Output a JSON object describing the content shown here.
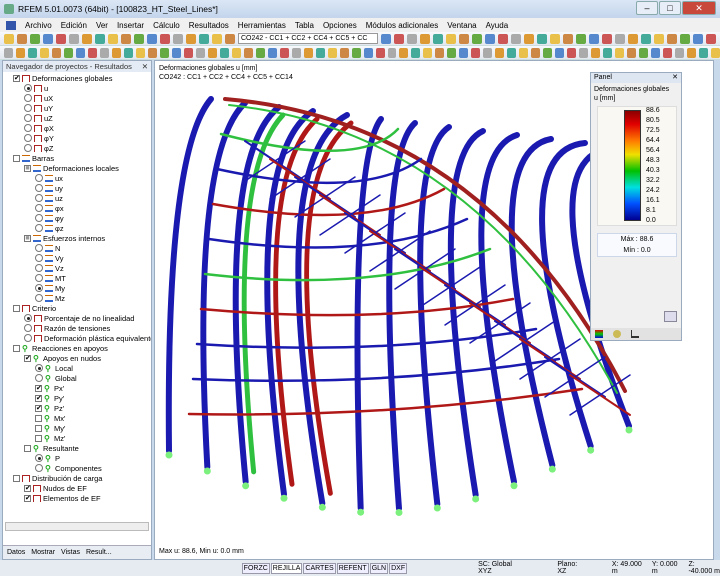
{
  "window": {
    "title": "RFEM 5.01.0073 (64bit) - [100823_HT_Steel_Lines*]",
    "min": "–",
    "max": "□",
    "close": "✕"
  },
  "menu": [
    "Archivo",
    "Edición",
    "Ver",
    "Insertar",
    "Cálculo",
    "Resultados",
    "Herramientas",
    "Tabla",
    "Opciones",
    "Módulos adicionales",
    "Ventana",
    "Ayuda"
  ],
  "toolbar": {
    "load_combo": "CO242 - CC1 + CC2 + CC4 + CC5 + CC"
  },
  "navigator": {
    "title": "Navegador de proyectos - Resultados",
    "close": "✕",
    "pin": "ᵖ",
    "nodes": [
      {
        "label": "Deformaciones globales",
        "lvl": 0,
        "ctl": "cb",
        "state": "on",
        "icon": "def"
      },
      {
        "label": "u",
        "lvl": 1,
        "ctl": "rb",
        "state": "on",
        "icon": "def"
      },
      {
        "label": "uX",
        "lvl": 1,
        "ctl": "rb",
        "state": "off",
        "icon": "def"
      },
      {
        "label": "uY",
        "lvl": 1,
        "ctl": "rb",
        "state": "off",
        "icon": "def"
      },
      {
        "label": "uZ",
        "lvl": 1,
        "ctl": "rb",
        "state": "off",
        "icon": "def"
      },
      {
        "label": "φX",
        "lvl": 1,
        "ctl": "rb",
        "state": "off",
        "icon": "def"
      },
      {
        "label": "φY",
        "lvl": 1,
        "ctl": "rb",
        "state": "off",
        "icon": "def"
      },
      {
        "label": "φZ",
        "lvl": 1,
        "ctl": "rb",
        "state": "off",
        "icon": "def"
      },
      {
        "label": "Barras",
        "lvl": 0,
        "ctl": "cb",
        "state": "off",
        "icon": "bar"
      },
      {
        "label": "Deformaciones locales",
        "lvl": 1,
        "ctl": "cb",
        "state": "part",
        "icon": "bar"
      },
      {
        "label": "ux",
        "lvl": 2,
        "ctl": "rb",
        "state": "off",
        "icon": "bar"
      },
      {
        "label": "uy",
        "lvl": 2,
        "ctl": "rb",
        "state": "off",
        "icon": "bar"
      },
      {
        "label": "uz",
        "lvl": 2,
        "ctl": "rb",
        "state": "off",
        "icon": "bar"
      },
      {
        "label": "φx",
        "lvl": 2,
        "ctl": "rb",
        "state": "off",
        "icon": "bar"
      },
      {
        "label": "φy",
        "lvl": 2,
        "ctl": "rb",
        "state": "off",
        "icon": "bar"
      },
      {
        "label": "φz",
        "lvl": 2,
        "ctl": "rb",
        "state": "off",
        "icon": "bar"
      },
      {
        "label": "Esfuerzos internos",
        "lvl": 1,
        "ctl": "cb",
        "state": "part",
        "icon": "bar"
      },
      {
        "label": "N",
        "lvl": 2,
        "ctl": "rb",
        "state": "off",
        "icon": "bar"
      },
      {
        "label": "Vy",
        "lvl": 2,
        "ctl": "rb",
        "state": "off",
        "icon": "bar"
      },
      {
        "label": "Vz",
        "lvl": 2,
        "ctl": "rb",
        "state": "off",
        "icon": "bar"
      },
      {
        "label": "MT",
        "lvl": 2,
        "ctl": "rb",
        "state": "off",
        "icon": "bar"
      },
      {
        "label": "My",
        "lvl": 2,
        "ctl": "rb",
        "state": "on",
        "icon": "bar"
      },
      {
        "label": "Mz",
        "lvl": 2,
        "ctl": "rb",
        "state": "off",
        "icon": "bar"
      },
      {
        "label": "Criterio",
        "lvl": 0,
        "ctl": "cb",
        "state": "off",
        "icon": "def"
      },
      {
        "label": "Porcentaje de no linealidad",
        "lvl": 1,
        "ctl": "rb",
        "state": "on",
        "icon": "def"
      },
      {
        "label": "Razón de tensiones",
        "lvl": 1,
        "ctl": "rb",
        "state": "off",
        "icon": "def"
      },
      {
        "label": "Deformación plástica equivalente",
        "lvl": 1,
        "ctl": "rb",
        "state": "off",
        "icon": "def"
      },
      {
        "label": "Reacciones en apoyos",
        "lvl": 0,
        "ctl": "cb",
        "state": "off",
        "icon": "sup"
      },
      {
        "label": "Apoyos en nudos",
        "lvl": 1,
        "ctl": "cb",
        "state": "on",
        "icon": "sup"
      },
      {
        "label": "Local",
        "lvl": 2,
        "ctl": "rb",
        "state": "on",
        "icon": "sup"
      },
      {
        "label": "Global",
        "lvl": 2,
        "ctl": "rb",
        "state": "off",
        "icon": "sup"
      },
      {
        "label": "Px'",
        "lvl": 2,
        "ctl": "cb",
        "state": "on",
        "icon": "sup"
      },
      {
        "label": "Py'",
        "lvl": 2,
        "ctl": "cb",
        "state": "on",
        "icon": "sup"
      },
      {
        "label": "Pz'",
        "lvl": 2,
        "ctl": "cb",
        "state": "on",
        "icon": "sup"
      },
      {
        "label": "Mx'",
        "lvl": 2,
        "ctl": "cb",
        "state": "off",
        "icon": "sup"
      },
      {
        "label": "My'",
        "lvl": 2,
        "ctl": "cb",
        "state": "off",
        "icon": "sup"
      },
      {
        "label": "Mz'",
        "lvl": 2,
        "ctl": "cb",
        "state": "off",
        "icon": "sup"
      },
      {
        "label": "Resultante",
        "lvl": 1,
        "ctl": "cb",
        "state": "off",
        "icon": "sup"
      },
      {
        "label": "P",
        "lvl": 2,
        "ctl": "rb",
        "state": "on",
        "icon": "sup"
      },
      {
        "label": "Componentes",
        "lvl": 2,
        "ctl": "rb",
        "state": "off",
        "icon": "sup"
      },
      {
        "label": "Distribución de carga",
        "lvl": 0,
        "ctl": "cb",
        "state": "off",
        "icon": "def"
      },
      {
        "label": "Nudos de EF",
        "lvl": 1,
        "ctl": "cb",
        "state": "on",
        "icon": "def"
      },
      {
        "label": "Elementos de EF",
        "lvl": 1,
        "ctl": "cb",
        "state": "on",
        "icon": "def"
      }
    ],
    "tabs": [
      "Datos",
      "Mostrar",
      "Vistas",
      "Result..."
    ]
  },
  "view": {
    "line1": "Deformaciones globales u [mm]",
    "line2": "CO242 : CC1 + CC2 + CC4 + CC5 + CC14",
    "footer": "Max u: 88.6, Min u: 0.0 mm"
  },
  "panel": {
    "title": "Panel",
    "close": "✕",
    "heading": "Deformaciones globales",
    "unit": "u [mm]",
    "legend": [
      "88.6",
      "80.5",
      "72.5",
      "64.4",
      "56.4",
      "48.3",
      "40.3",
      "32.2",
      "24.2",
      "16.1",
      "8.1",
      "0.0"
    ],
    "max_label": "Máx :",
    "max": "88.6",
    "min_label": "Mín :",
    "min": "0.0"
  },
  "status": {
    "buttons": [
      "FORZC",
      "REJILLA",
      "CARTES",
      "REFENT",
      "GLN",
      "DXF"
    ],
    "active": "REJILLA",
    "sc": "SC: Global XYZ",
    "plane": "Plano: XZ",
    "x": "X: 49.000 m",
    "y": "Y: 0.000 m",
    "z": "Z: -40.000 m"
  },
  "colors": {
    "blue": "#1a1ab0",
    "red": "#b01818",
    "green": "#30c040",
    "yellow": "#e8d020"
  }
}
